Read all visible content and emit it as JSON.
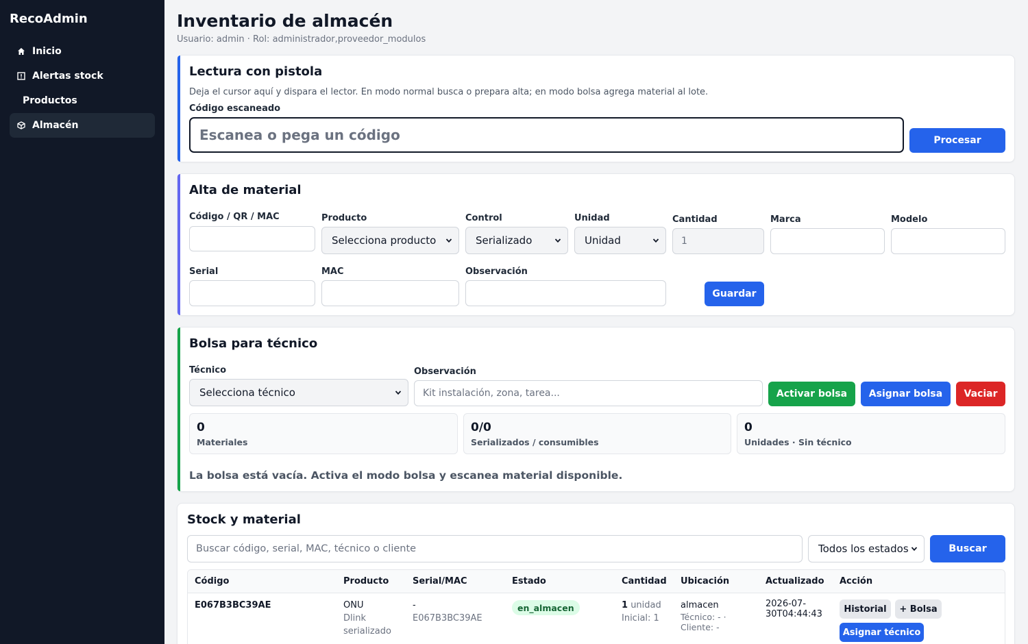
{
  "app": {
    "brand": "RecoAdmin"
  },
  "sidebar": {
    "items": [
      {
        "label": "Inicio",
        "icon": "home-icon"
      },
      {
        "label": "Alertas stock",
        "icon": "alert-box-icon"
      },
      {
        "label": "Productos",
        "icon": ""
      },
      {
        "label": "Almacén",
        "icon": "box-icon",
        "active": true
      }
    ]
  },
  "page": {
    "title": "Inventario de almacén",
    "subtitle": "Usuario: admin · Rol: administrador,proveedor_modulos"
  },
  "scanner": {
    "title": "Lectura con pistola",
    "note": "Deja el cursor aquí y dispara el lector. En modo normal busca o prepara alta; en modo bolsa agrega material al lote.",
    "field_label": "Código escaneado",
    "placeholder": "Escanea o pega un código",
    "button": "Procesar",
    "accent": "#2563eb"
  },
  "alta": {
    "title": "Alta de material",
    "accent": "#6366f1",
    "labels": {
      "codigo": "Código / QR / MAC",
      "producto": "Producto",
      "control": "Control",
      "unidad": "Unidad",
      "cantidad": "Cantidad",
      "marca": "Marca",
      "modelo": "Modelo",
      "serial": "Serial",
      "mac": "MAC",
      "observacion": "Observación"
    },
    "values": {
      "producto": "Selecciona producto",
      "control": "Serializado",
      "unidad": "Unidad",
      "cantidad": "1"
    },
    "button": "Guardar"
  },
  "bolsa": {
    "title": "Bolsa para técnico",
    "accent": "#16a34a",
    "tecnico_label": "Técnico",
    "tecnico_value": "Selecciona técnico",
    "obs_label": "Observación",
    "obs_placeholder": "Kit instalación, zona, tarea...",
    "buttons": {
      "activar": "Activar bolsa",
      "asignar": "Asignar bolsa",
      "vaciar": "Vaciar"
    },
    "stats": [
      {
        "value": "0",
        "caption": "Materiales"
      },
      {
        "value": "0/0",
        "caption": "Serializados / consumibles"
      },
      {
        "value": "0",
        "caption": "Unidades · Sin técnico"
      }
    ],
    "empty": "La bolsa está vacía. Activa el modo bolsa y escanea material disponible."
  },
  "stock": {
    "title": "Stock y material",
    "search_placeholder": "Buscar código, serial, MAC, técnico o cliente",
    "estado_filter": "Todos los estados",
    "button": "Buscar",
    "columns": [
      "Código",
      "Producto",
      "Serial/MAC",
      "Estado",
      "Cantidad",
      "Ubicación",
      "Actualizado",
      "Acción"
    ],
    "rows": [
      {
        "codigo": "E067B3BC39AE",
        "producto": "ONU",
        "producto_sub1": "Dlink",
        "producto_sub2": "serializado",
        "serial": "-",
        "mac": "E067B3BC39AE",
        "estado": "en_almacen",
        "cantidad_num": "1",
        "cantidad_unit": "unidad",
        "cantidad_inicial": "Inicial: 1",
        "ubicacion": "almacen",
        "tecnico": "Técnico: - ·",
        "cliente": "Cliente: -",
        "actualizado_1": "2026-07-",
        "actualizado_2": "30T04:44:43",
        "acciones": {
          "historial": "Historial",
          "bolsa": "+ Bolsa",
          "asignar": "Asignar técnico"
        }
      }
    ]
  }
}
